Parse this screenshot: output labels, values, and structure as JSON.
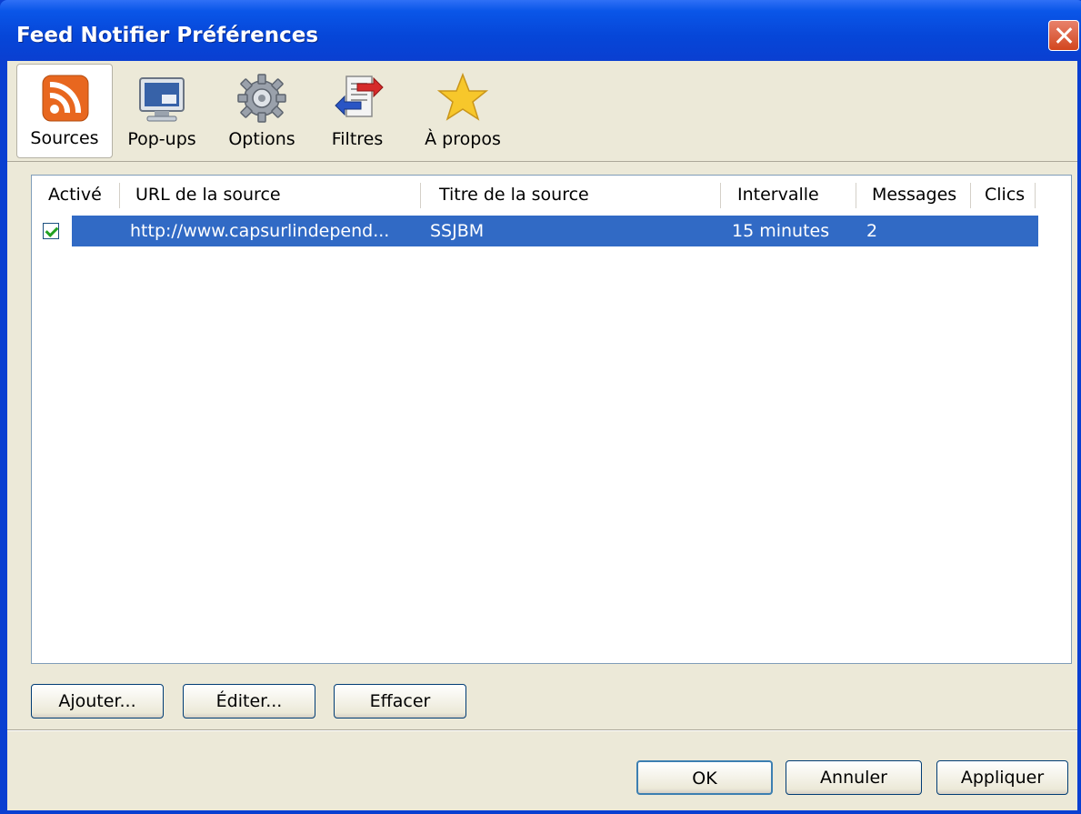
{
  "window": {
    "title": "Feed Notifier Préférences"
  },
  "toolbar": {
    "items": [
      {
        "label": "Sources",
        "icon": "rss-icon",
        "active": true
      },
      {
        "label": "Pop-ups",
        "icon": "monitor-icon",
        "active": false
      },
      {
        "label": "Options",
        "icon": "gear-icon",
        "active": false
      },
      {
        "label": "Filtres",
        "icon": "filter-arrows-icon",
        "active": false
      },
      {
        "label": "À propos",
        "icon": "star-icon",
        "active": false
      }
    ]
  },
  "table": {
    "columns": [
      "Activé",
      "URL de la source",
      "Titre de la source",
      "Intervalle",
      "Messages",
      "Clics"
    ],
    "rows": [
      {
        "enabled": true,
        "url": "http://www.capsurlindepend...",
        "title": "SSJBM",
        "interval": "15 minutes",
        "messages": "2",
        "clicks": ""
      }
    ]
  },
  "actions": {
    "add": "Ajouter...",
    "edit": "Éditer...",
    "delete": "Effacer"
  },
  "dialog": {
    "ok": "OK",
    "cancel": "Annuler",
    "apply": "Appliquer"
  },
  "colors": {
    "titlebar": "#0a56e8",
    "selection": "#316ac5",
    "rss": "#e8671f",
    "close": "#d2461e"
  }
}
